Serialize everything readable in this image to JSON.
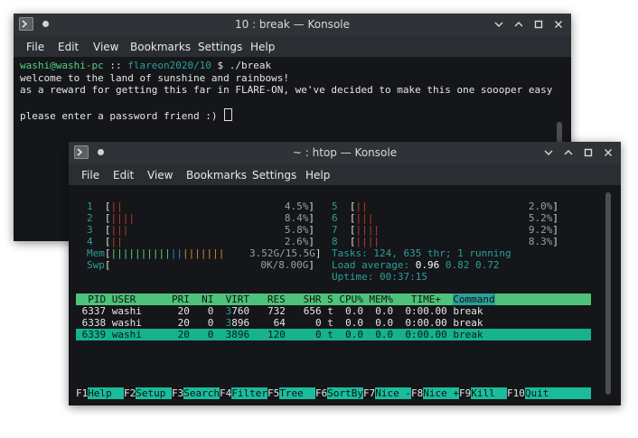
{
  "back_window": {
    "title": "10 : break — Konsole",
    "menu": [
      "File",
      "Edit",
      "View",
      "Bookmarks",
      "Settings",
      "Help"
    ],
    "prompt_user": "washi@washi-pc",
    "prompt_sep": " :: ",
    "prompt_dir": "flareon2020/10",
    "prompt_cmd": " $ ./break",
    "line1": "welcome to the land of sunshine and rainbows!",
    "line2": "as a reward for getting this far in FLARE-ON, we've decided to make this one soooper easy",
    "line3": "please enter a password friend :) "
  },
  "front_window": {
    "title": "~ : htop — Konsole",
    "menu": [
      "File",
      "Edit",
      "View",
      "Bookmarks",
      "Settings",
      "Help"
    ]
  },
  "htop": {
    "cpus_left": [
      {
        "id": "1",
        "bars": "||",
        "pct": "4.5%"
      },
      {
        "id": "2",
        "bars": "||||",
        "pct": "8.4%"
      },
      {
        "id": "3",
        "bars": "|||",
        "pct": "5.8%"
      },
      {
        "id": "4",
        "bars": "||",
        "pct": "2.6%"
      }
    ],
    "cpus_right": [
      {
        "id": "5",
        "bars": "||",
        "pct": "2.0%"
      },
      {
        "id": "6",
        "bars": "|||",
        "pct": "5.2%"
      },
      {
        "id": "7",
        "bars": "||||",
        "pct": "9.2%"
      },
      {
        "id": "8",
        "bars": "||||",
        "pct": "8.3%"
      }
    ],
    "mem_label": "Mem",
    "mem_bars_green": "||||||||||",
    "mem_bars_blue": "||",
    "mem_bars_yellow": "|||||||",
    "mem_value": "3.52G/15.5G",
    "swp_label": "Swp",
    "swp_value": "0K/8.00G",
    "tasks_label": "Tasks: ",
    "tasks_value": "124, 635 thr; 1 running",
    "load_label": "Load average: ",
    "load_1": "0.96",
    "load_5": "0.82",
    "load_15": "0.72",
    "uptime_label": "Uptime: ",
    "uptime_value": "00:37:15",
    "header": "  PID USER      PRI  NI  VIRT   RES   SHR S CPU% MEM%   TIME+  ",
    "header_sorted": "Command",
    "rows": [
      {
        "pid": " 6337",
        "user": "washi",
        "pri": "20",
        "ni": "0",
        "virt_a": "3",
        "virt_b": "760",
        "res": "732",
        "shr": "656",
        "s": "t",
        "cpu": "0.0",
        "mem": "0.0",
        "time": "0:00.00",
        "cmd": "break"
      },
      {
        "pid": " 6338",
        "user": "washi",
        "pri": "20",
        "ni": "0",
        "virt_a": "3",
        "virt_b": "896",
        "res": "64",
        "shr": "0",
        "s": "t",
        "cpu": "0.0",
        "mem": "0.0",
        "time": "0:00.00",
        "cmd": "break"
      },
      {
        "pid": " 6339",
        "user": "washi",
        "pri": "20",
        "ni": "0",
        "virt_a": "3",
        "virt_b": "896",
        "res": "120",
        "shr": "0",
        "s": "t",
        "cpu": "0.0",
        "mem": "0.0",
        "time": "0:00.00",
        "cmd": "break"
      }
    ],
    "fkeys": [
      {
        "key": "F1",
        "label": "Help  "
      },
      {
        "key": "F2",
        "label": "Setup "
      },
      {
        "key": "F3",
        "label": "Search"
      },
      {
        "key": "F4",
        "label": "Filter"
      },
      {
        "key": "F5",
        "label": "Tree  "
      },
      {
        "key": "F6",
        "label": "SortBy"
      },
      {
        "key": "F7",
        "label": "Nice -"
      },
      {
        "key": "F8",
        "label": "Nice +"
      },
      {
        "key": "F9",
        "label": "Kill  "
      },
      {
        "key": "F10",
        "label": "Quit"
      }
    ]
  },
  "colors": {
    "green_text": "#55d17f",
    "teal": "#1abc9c",
    "cyan_text": "#2aa198",
    "red_bar": "#c0392b",
    "header_bg": "#4ec27a",
    "selected_bg": "#16b28e"
  }
}
